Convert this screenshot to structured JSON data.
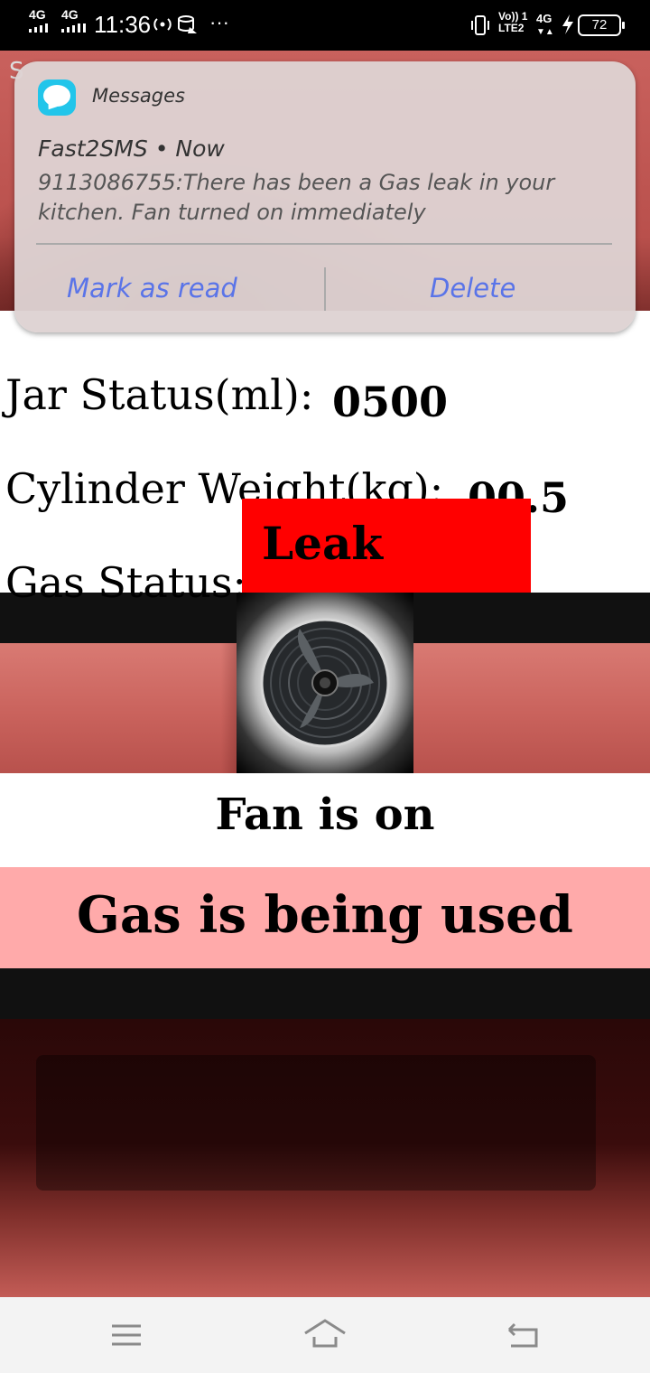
{
  "status_bar": {
    "network_1": "4G",
    "network_2": "4G",
    "time": "11:36",
    "more": "···",
    "volte_line1": "Vo)) 1",
    "volte_line2": "LTE2",
    "network_3": "4G",
    "battery": "72"
  },
  "notification": {
    "app_name": "Messages",
    "sender": "Fast2SMS • Now",
    "message": "9113086755:There has been a Gas leak in your kitchen. Fan turned on immediately",
    "action_mark_read": "Mark as read",
    "action_delete": "Delete"
  },
  "app": {
    "title_peek": "S",
    "jar_status_label": "Jar Status(ml):",
    "jar_status_value": "0500",
    "cylinder_weight_label": "Cylinder Weight(kg):",
    "cylinder_weight_value": "00.5",
    "gas_status_label": "Gas Status:",
    "gas_status_value": "Leak",
    "fan_status": "Fan is on",
    "usage_status": "Gas is being used",
    "colors": {
      "gas_leak_badge": "#ff0000",
      "usage_banner": "#ffaaaa",
      "notification_action": "#5a74e8",
      "messages_icon": "#22c5ea"
    }
  },
  "nav_bar": {
    "menu_icon": "menu-icon",
    "home_icon": "home-icon",
    "back_icon": "back-icon"
  }
}
